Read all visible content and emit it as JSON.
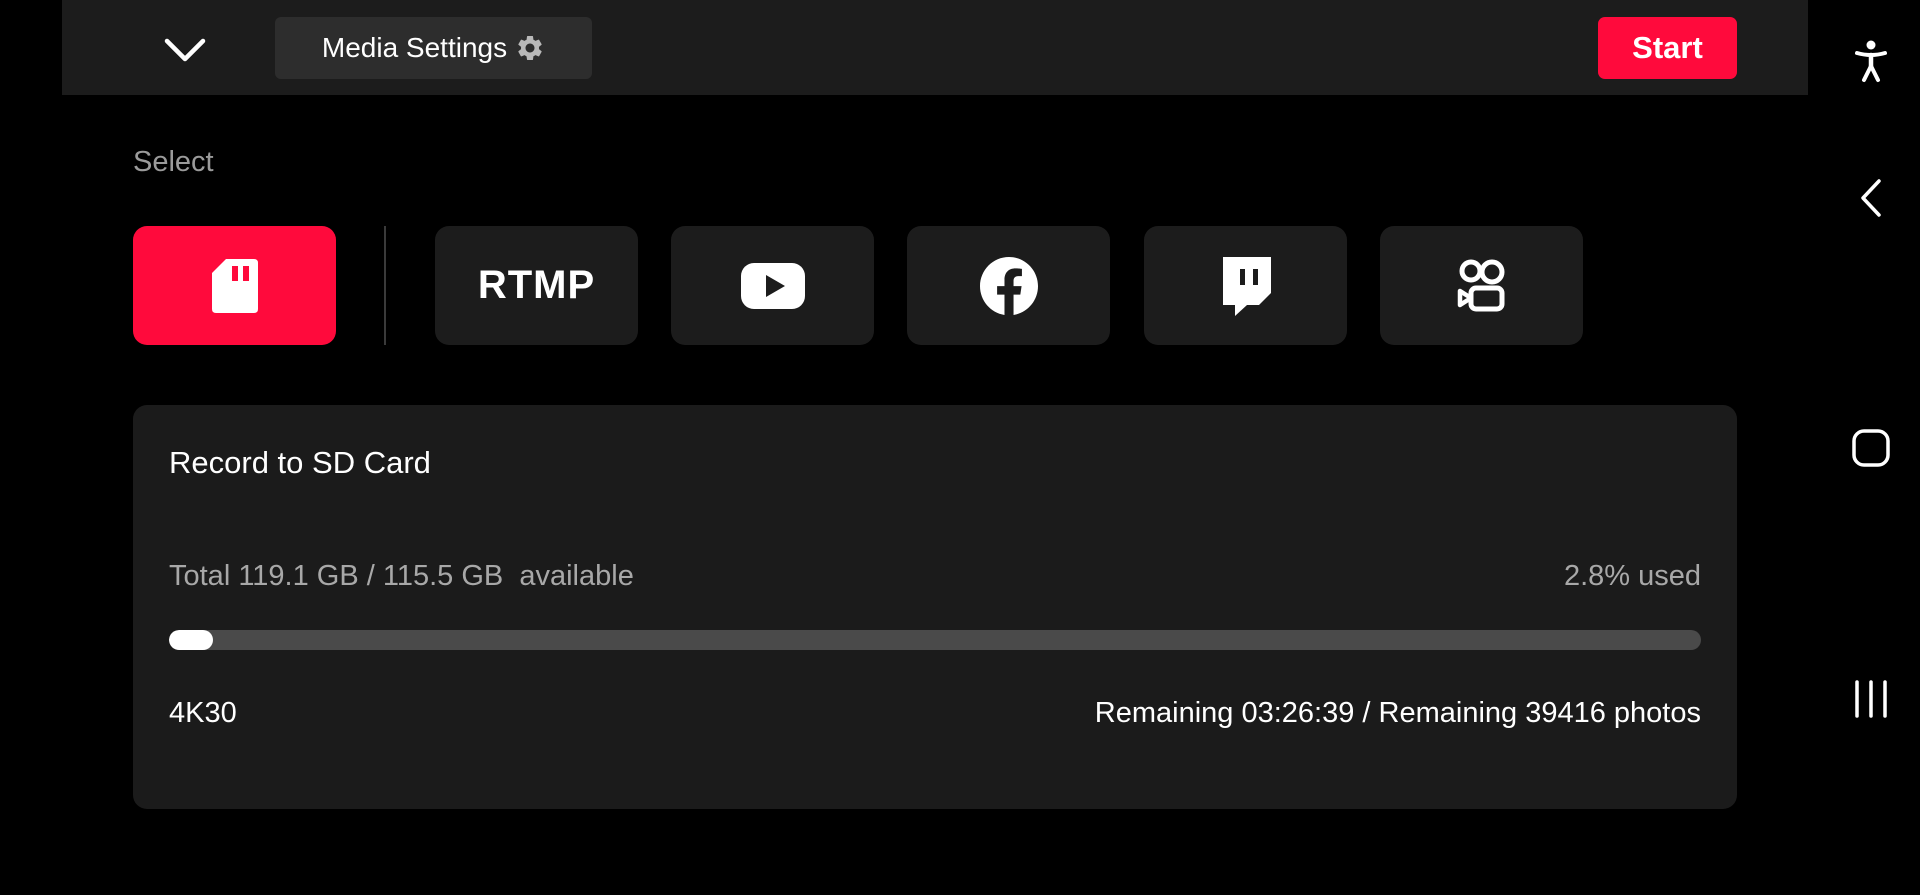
{
  "header": {
    "collapse_icon": "chevron-down-icon",
    "media_settings_label": "Media Settings",
    "media_settings_icon": "gear-icon",
    "start_label": "Start",
    "accent_color": "#ff0a3c"
  },
  "select": {
    "label": "Select",
    "rtmp_label": "RTMP",
    "options": [
      {
        "icon": "sd-card-icon",
        "selected": true
      },
      {
        "icon": "rtmp-icon",
        "selected": false
      },
      {
        "icon": "youtube-icon",
        "selected": false
      },
      {
        "icon": "facebook-icon",
        "selected": false
      },
      {
        "icon": "twitch-icon",
        "selected": false
      },
      {
        "icon": "kuaishou-icon",
        "selected": false
      }
    ]
  },
  "card": {
    "title": "Record to SD Card",
    "storage_info": "Total 119.1 GB / 115.5 GB  available",
    "used_text": "2.8% used",
    "used_fraction": 0.028,
    "resolution": "4K30",
    "remaining": "Remaining 03:26:39 / Remaining 39416 photos"
  },
  "system_nav": {
    "icons": [
      "accessibility-icon",
      "back-icon",
      "home-icon",
      "recent-apps-icon"
    ]
  }
}
